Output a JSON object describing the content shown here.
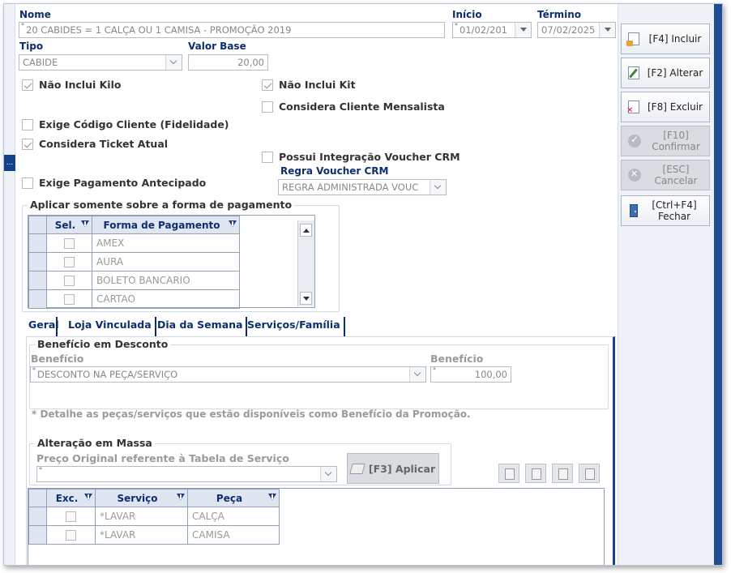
{
  "form": {
    "nome_label": "Nome",
    "nome_value": "20 CABIDES = 1 CALÇA OU 1 CAMISA - PROMOÇÃO 2019",
    "inicio_label": "Início",
    "inicio_value": "01/02/201",
    "termino_label": "Término",
    "termino_value": "07/02/2025",
    "tipo_label": "Tipo",
    "tipo_value": "CABIDE",
    "valor_base_label": "Valor Base",
    "valor_base_value": "20,00",
    "required_mark": "*"
  },
  "checkboxes": {
    "nao_inclui_kilo": {
      "label": "Não Inclui Kilo",
      "checked": true
    },
    "nao_inclui_kit": {
      "label": "Não Inclui Kit",
      "checked": true
    },
    "considera_cliente_mensalista": {
      "label": "Considera Cliente Mensalista",
      "checked": false
    },
    "exige_codigo_cliente": {
      "label": "Exige Código Cliente (Fidelidade)",
      "checked": false
    },
    "considera_ticket_atual": {
      "label": "Considera Ticket Atual",
      "checked": true
    },
    "possui_integracao_voucher": {
      "label": "Possui Integração Voucher CRM",
      "checked": false
    },
    "exige_pagamento_antecipado": {
      "label": "Exige Pagamento Antecipado",
      "checked": false
    }
  },
  "voucher": {
    "regra_label": "Regra Voucher CRM",
    "regra_value": "REGRA ADMINISTRADA VOUC"
  },
  "pagamento": {
    "group_title": "Aplicar somente sobre a forma de pagamento",
    "columns": [
      "Sel.",
      "Forma de Pagamento"
    ],
    "rows": [
      "AMEX",
      "AURA",
      "BOLETO BANCARIO",
      "CARTAO"
    ]
  },
  "tabs": [
    "Geral",
    "Loja Vinculada",
    "Dia da Semana",
    "Serviços/Família"
  ],
  "beneficio": {
    "group_title": "Benefício em Desconto",
    "beneficio_label": "Benefício",
    "beneficio_value": "DESCONTO NA PEÇA/SERVIÇO",
    "valor_label": "Benefício",
    "valor_value": "100,00",
    "note": "* Detalhe as peças/serviços que estão disponíveis como Benefício da Promoção."
  },
  "massa": {
    "group_title": "Alteração em Massa",
    "preco_label": "Preço Original referente à Tabela de Serviço",
    "preco_value": "",
    "aplicar_label": "[F3] Aplicar"
  },
  "servicos_grid": {
    "columns": [
      "Exc.",
      "Serviço",
      "Peça"
    ],
    "rows": [
      {
        "servico": "*LAVAR",
        "peca": "CALÇA"
      },
      {
        "servico": "*LAVAR",
        "peca": "CAMISA"
      }
    ]
  },
  "toolbar": {
    "incluir": "[F4] Incluir",
    "alterar": "[F2] Alterar",
    "excluir": "[F8] Excluir",
    "confirmar": "[F10]\nConfirmar",
    "cancelar": "[ESC]\nCancelar",
    "fechar": "[Ctrl+F4]\nFechar"
  },
  "left_marker": "..."
}
